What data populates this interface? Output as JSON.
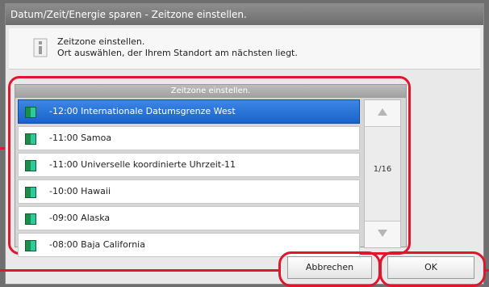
{
  "window": {
    "title": "Datum/Zeit/Energie sparen - Zeitzone einstellen."
  },
  "info": {
    "line1": "Zeitzone einstellen.",
    "line2": "Ort auswählen, der Ihrem Standort am nächsten liegt."
  },
  "list": {
    "header": "Zeitzone einstellen.",
    "items": [
      {
        "label": "-12:00 Internationale Datumsgrenze West",
        "selected": true
      },
      {
        "label": "-11:00 Samoa",
        "selected": false
      },
      {
        "label": "-11:00 Universelle koordinierte Uhrzeit-11",
        "selected": false
      },
      {
        "label": "-10:00 Hawaii",
        "selected": false
      },
      {
        "label": "-09:00 Alaska",
        "selected": false
      },
      {
        "label": "-08:00 Baja California",
        "selected": false
      }
    ],
    "page": "1/16"
  },
  "buttons": {
    "cancel": "Abbrechen",
    "ok": "OK"
  },
  "colors": {
    "highlight": "#e0162f",
    "selected_row": "#1a63c9"
  }
}
